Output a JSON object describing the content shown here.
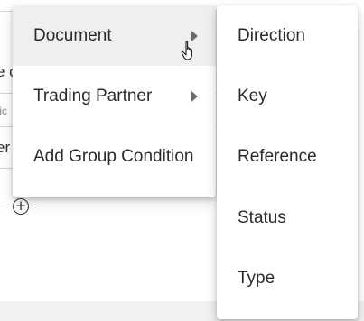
{
  "background": {
    "fragment_1": "e c",
    "fragment_2": "tic",
    "fragment_3": "er"
  },
  "main_menu": {
    "items": [
      {
        "label": "Document",
        "has_submenu": true,
        "active": true
      },
      {
        "label": "Trading Partner",
        "has_submenu": true,
        "active": false
      },
      {
        "label": "Add Group Condition",
        "has_submenu": false,
        "active": false
      }
    ]
  },
  "submenu": {
    "items": [
      {
        "label": "Direction"
      },
      {
        "label": "Key"
      },
      {
        "label": "Reference"
      },
      {
        "label": "Status"
      },
      {
        "label": "Type"
      }
    ]
  },
  "icons": {
    "add_condition": "plus-circle-icon",
    "cursor": "hand-pointer-icon",
    "submenu_indicator": "caret-right-icon"
  }
}
